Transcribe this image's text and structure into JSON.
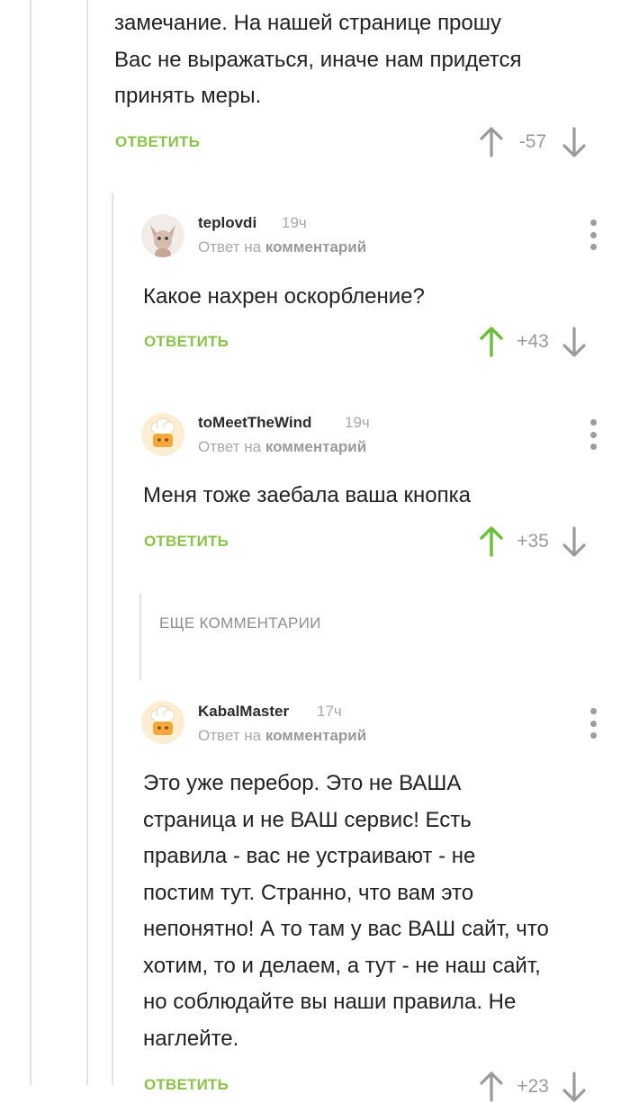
{
  "comments": [
    {
      "text_lines": [
        "замечание. На нашей странице прошу",
        "Вас не выражаться, иначе нам придется",
        "принять меры."
      ],
      "reply_label": "ОТВЕТИТЬ",
      "score": "-57"
    },
    {
      "username": "teplovdi",
      "time": "19ч",
      "reply_to_prefix": "Ответ на",
      "reply_to_link": "комментарий",
      "text_lines": [
        "Какое нахрен оскорбление?"
      ],
      "reply_label": "ОТВЕТИТЬ",
      "score": "+43"
    },
    {
      "username": "toMeetTheWind",
      "time": "19ч",
      "reply_to_prefix": "Ответ на",
      "reply_to_link": "комментарий",
      "text_lines": [
        "Меня тоже заебала ваша кнопка"
      ],
      "reply_label": "ОТВЕТИТЬ",
      "score": "+35"
    },
    {
      "username": "KabalMaster",
      "time": "17ч",
      "reply_to_prefix": "Ответ на",
      "reply_to_link": "комментарий",
      "text_lines": [
        "Это уже перебор. Это не ВАША",
        "страница и не ВАШ сервис! Есть",
        "правила - вас не устраивают - не",
        "постим тут. Странно, что вам это",
        "непонятно! А то там у вас ВАШ сайт, что",
        "хотим, то и делаем, а тут - не наш сайт,",
        "но соблюдайте вы наши правила. Не",
        "наглейте."
      ],
      "reply_label": "ОТВЕТИТЬ",
      "score": "+23"
    }
  ],
  "more_comments_label": "ЕЩЕ КОММЕНТАРИИ",
  "colors": {
    "accent_green": "#8bc34a",
    "muted_gray": "#9a9a9a",
    "thread_line": "#e2e2e2"
  },
  "icons": {
    "upvote": "arrow-up-icon",
    "downvote": "arrow-down-icon",
    "menu": "more-vertical-icon",
    "avatar_default": "chef-hat-icon"
  }
}
